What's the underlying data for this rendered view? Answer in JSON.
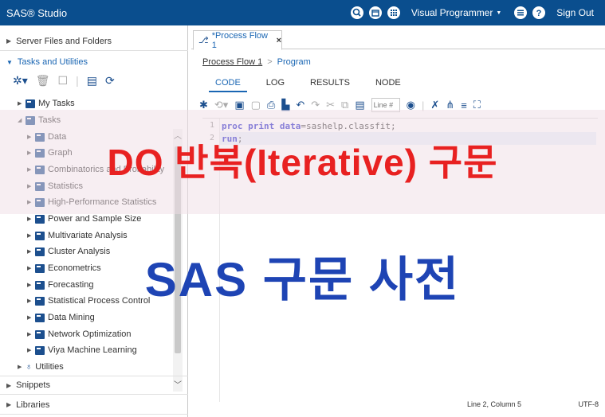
{
  "app": {
    "title": "SAS® Studio"
  },
  "topbar": {
    "perspective": "Visual Programmer",
    "sign_out": "Sign Out"
  },
  "left": {
    "sections": {
      "server_files": "Server Files and Folders",
      "tasks_utilities": "Tasks and Utilities",
      "snippets": "Snippets",
      "libraries": "Libraries"
    },
    "tree": {
      "my_tasks": "My Tasks",
      "tasks": "Tasks",
      "items": [
        "Data",
        "Graph",
        "Combinatorics and Probability",
        "Statistics",
        "High-Performance Statistics",
        "Power and Sample Size",
        "Multivariate Analysis",
        "Cluster Analysis",
        "Econometrics",
        "Forecasting",
        "Statistical Process Control",
        "Data Mining",
        "Network Optimization",
        "Viya Machine Learning"
      ],
      "utilities": "Utilities"
    }
  },
  "right": {
    "tab": {
      "label": "*Process Flow 1",
      "close": "×"
    },
    "breadcrumb": {
      "flow": "Process Flow 1",
      "sep": ">",
      "program": "Program"
    },
    "subtabs": [
      "CODE",
      "LOG",
      "RESULTS",
      "NODE"
    ],
    "line_input": {
      "placeholder": "Line #"
    },
    "code": {
      "line_numbers": [
        "1",
        "2"
      ],
      "line1_kw1": "proc",
      "line1_kw2": "print",
      "line1_kw3": "data",
      "line1_rest": "=sashelp.classfit;",
      "line2_kw": "run",
      "line2_rest": ";"
    },
    "status": {
      "position": "Line 2, Column 5",
      "encoding": "UTF-8"
    }
  },
  "overlay": {
    "line1": "DO 반복(Iterative) 구문",
    "line2": "SAS 구문 사전"
  },
  "colors": {
    "topbar": "#0a4e8e",
    "accent": "#1a66b3",
    "overlay_red": "#e82121",
    "overlay_blue": "#1e44b4"
  }
}
